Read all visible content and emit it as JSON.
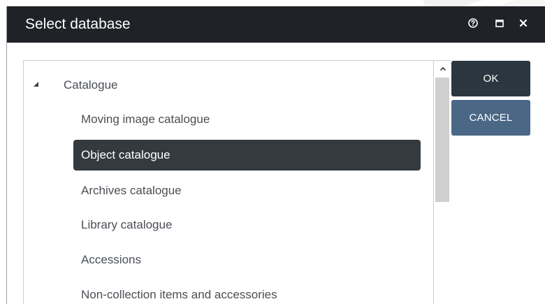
{
  "dialog": {
    "title": "Select database",
    "help_icon": "help-circle-icon",
    "maximize_icon": "maximize-icon",
    "close_icon": "close-icon"
  },
  "tree": {
    "root": {
      "label": "Catalogue",
      "expanded": true,
      "children": [
        {
          "label": "Moving image catalogue",
          "selected": false
        },
        {
          "label": "Object catalogue",
          "selected": true
        },
        {
          "label": "Archives catalogue",
          "selected": false
        },
        {
          "label": "Library catalogue",
          "selected": false
        },
        {
          "label": "Accessions",
          "selected": false
        },
        {
          "label": "Non-collection items and accessories",
          "selected": false
        }
      ]
    },
    "scrollbar": {
      "up_icon": "chevron-up-icon"
    }
  },
  "buttons": {
    "ok_label": "OK",
    "cancel_label": "CANCEL"
  },
  "colors": {
    "titlebar": "#1f2328",
    "selected_row": "#343b40",
    "ok_button": "#2b3640",
    "cancel_button": "#4a6785",
    "text": "#4a4f55"
  }
}
